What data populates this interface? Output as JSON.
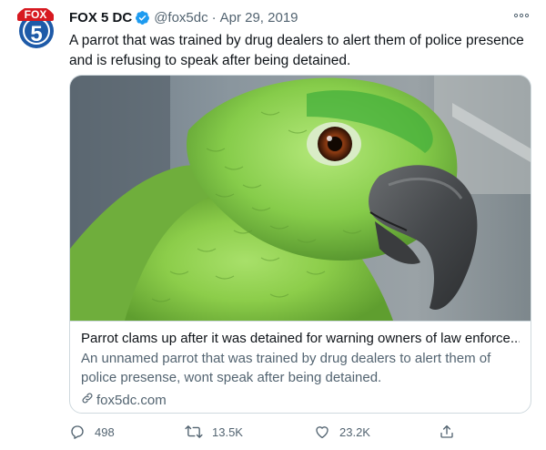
{
  "author": {
    "avatar_text_top": "FOX",
    "avatar_text_main": "5",
    "display_name": "FOX 5 DC",
    "handle": "@fox5dc",
    "separator": "·",
    "date": "Apr 29, 2019"
  },
  "tweet": {
    "text": "A parrot that was trained by drug dealers to alert them of police presence and is refusing to speak after being detained."
  },
  "card": {
    "title": "Parrot clams up after it was detained for warning owners of law enforce...",
    "description": "An unnamed parrot that was trained by drug dealers to alert them of police presense, wont speak after being detained.",
    "domain": "fox5dc.com"
  },
  "actions": {
    "reply_count": "498",
    "retweet_count": "13.5K",
    "like_count": "23.2K"
  },
  "icons": {
    "more": "more-icon",
    "verified": "verified-badge-icon",
    "reply": "reply-icon",
    "retweet": "retweet-icon",
    "like": "like-icon",
    "share": "share-icon",
    "link": "link-icon"
  },
  "colors": {
    "verified": "#1d9bf0",
    "text_primary": "#0f1419",
    "text_secondary": "#536471",
    "border": "#cfd9de",
    "fox_red": "#d71920",
    "fox_blue": "#1e5aa8"
  }
}
